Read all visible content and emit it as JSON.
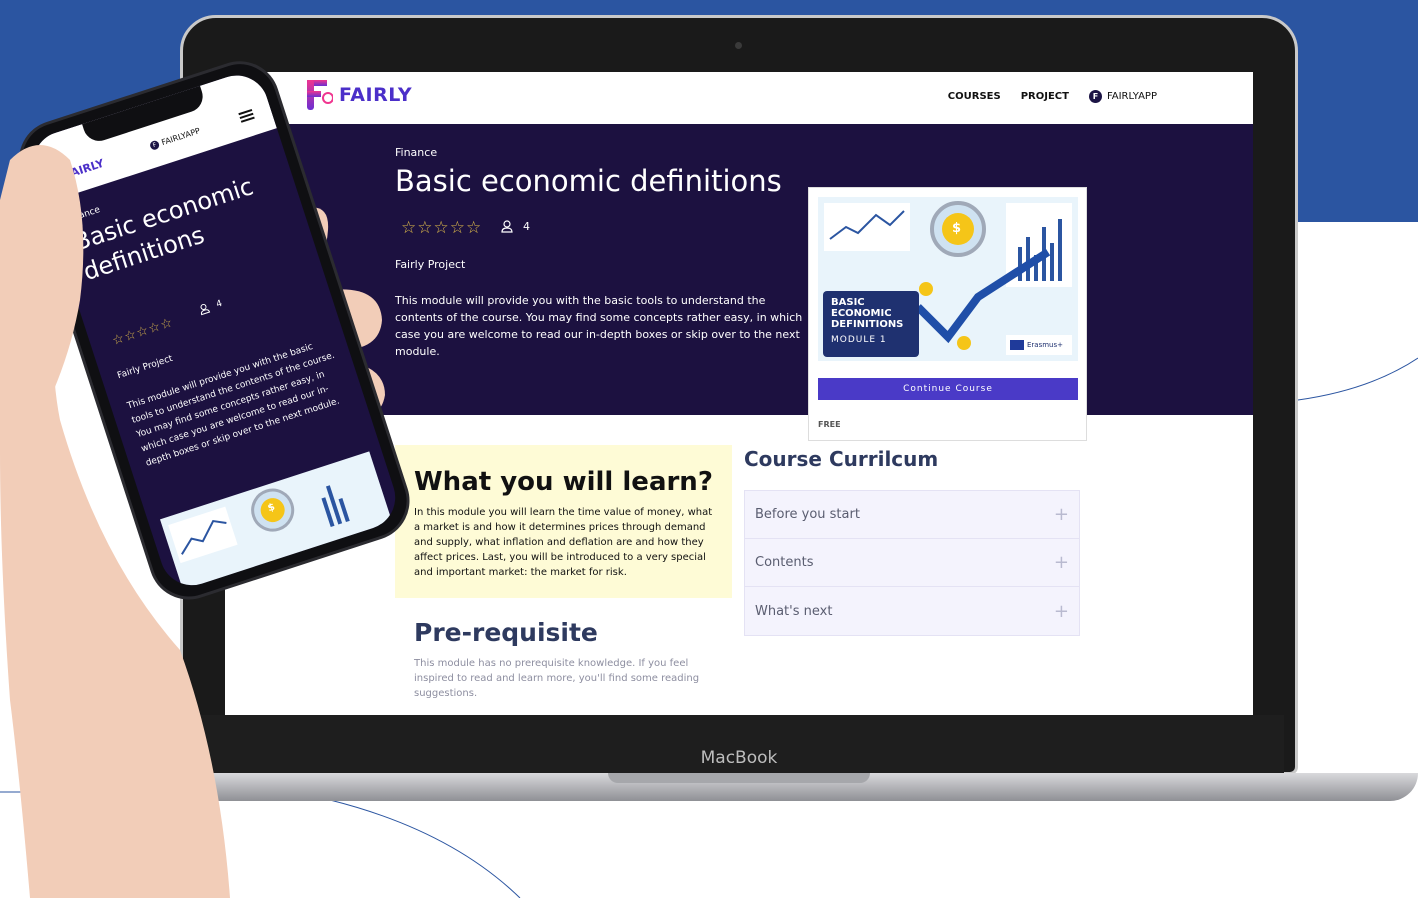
{
  "laptop": {
    "brand": "MacBook",
    "nav": {
      "logo": "FAIRLY",
      "links": [
        "COURSES",
        "PROJECT"
      ],
      "app_icon_letter": "F",
      "app_label": "FAIRLYAPP"
    },
    "hero": {
      "category": "Finance",
      "title": "Basic economic definitions",
      "rating_stars": "☆☆☆☆☆",
      "enrolled_count": "4",
      "project": "Fairly Project",
      "description": "This module will provide you with the basic tools to understand the contents of the course. You may find some concepts rather easy, in which case you are welcome to read our in-depth boxes or skip over to the next module."
    },
    "card": {
      "image_title_lines": [
        "BASIC",
        "ECONOMIC",
        "DEFINITIONS"
      ],
      "image_module": "MODULE 1",
      "image_badge": "Erasmus+",
      "coin_symbol": "$",
      "button": "Continue Course",
      "price": "FREE"
    },
    "learn": {
      "title": "What you will learn?",
      "text": "In this module you will learn the time value of money, what a market is and how it determines prices through demand and supply, what inflation and deflation are and how they affect prices. Last, you will be introduced to a very special and important market: the market for risk."
    },
    "prerequisite": {
      "title": "Pre-requisite",
      "text": "This module has no prerequisite knowledge. If you feel inspired to read and learn more, you'll find some reading suggestions."
    },
    "curriculum": {
      "title": "Course Currilcum",
      "items": [
        "Before you start",
        "Contents",
        "What's next"
      ]
    }
  },
  "phone": {
    "logo": "FAIRLY",
    "app_icon_letter": "F",
    "app_label": "FAIRLYAPP",
    "category": "Finance",
    "title": "Basic economic definitions",
    "rating_stars": "☆☆☆☆☆",
    "enrolled_count": "4",
    "project": "Fairly Project",
    "description": "This module will provide you with the basic tools to understand the contents of the course. You may find some concepts rather easy, in which case you are welcome to read our in-depth boxes or skip over to the next module.",
    "coin_symbol": "$"
  },
  "colors": {
    "background_band": "#2b55a1",
    "hero_bg": "#1c1140",
    "accent": "#4a3ac7",
    "logo": "#4b2fc9",
    "learn_bg": "#fefbd6",
    "star": "#d9b64a"
  },
  "icons": {
    "user": "user-icon",
    "plus": "plus-icon",
    "menu": "hamburger-menu-icon"
  }
}
